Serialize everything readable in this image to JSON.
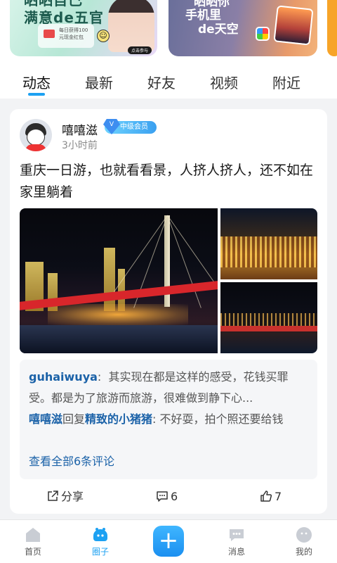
{
  "banners": {
    "left": {
      "title_line1": "晒晒自己",
      "title_line2": "满意de五官",
      "card_text": "每日获得100元现金红包",
      "button": "点击参与"
    },
    "right": {
      "title_line1": "晒晒你",
      "title_line2": "手机里",
      "title_line3": "de天空"
    }
  },
  "tabs": [
    {
      "label": "动态",
      "active": true
    },
    {
      "label": "最新",
      "active": false
    },
    {
      "label": "好友",
      "active": false
    },
    {
      "label": "视频",
      "active": false
    },
    {
      "label": "附近",
      "active": false
    }
  ],
  "post": {
    "username": "嘻嘻滋",
    "vip_badge": "中级会员",
    "vip_level": "V",
    "time": "3小时前",
    "text": "重庆一日游，也就看看景，人挤人挤人，还不如在家里躺着",
    "comments": [
      {
        "user": "guhaiwuya",
        "separator": ":",
        "text": "其实现在都是这样的感受，花钱买罪受。都是为了旅游而旅游，很难做到静下心..."
      },
      {
        "user": "嘻嘻滋",
        "reply_word": "回复",
        "reply_to": "精致的小猪猪",
        "separator": ":",
        "text": "不好耍，拍个照还要给钱"
      }
    ],
    "see_all": "查看全部6条评论",
    "actions": {
      "share": "分享",
      "comments": "6",
      "likes": "7"
    }
  },
  "bottom_nav": [
    {
      "label": "首页",
      "icon": "home-icon",
      "active": false
    },
    {
      "label": "圈子",
      "icon": "circle-icon",
      "active": true
    },
    {
      "label": "",
      "icon": "plus-icon",
      "active": false
    },
    {
      "label": "消息",
      "icon": "message-icon",
      "active": false
    },
    {
      "label": "我的",
      "icon": "profile-icon",
      "active": false
    }
  ],
  "colors": {
    "accent": "#1da1f2",
    "link": "#1b62a8",
    "background": "#f2f3f5"
  }
}
